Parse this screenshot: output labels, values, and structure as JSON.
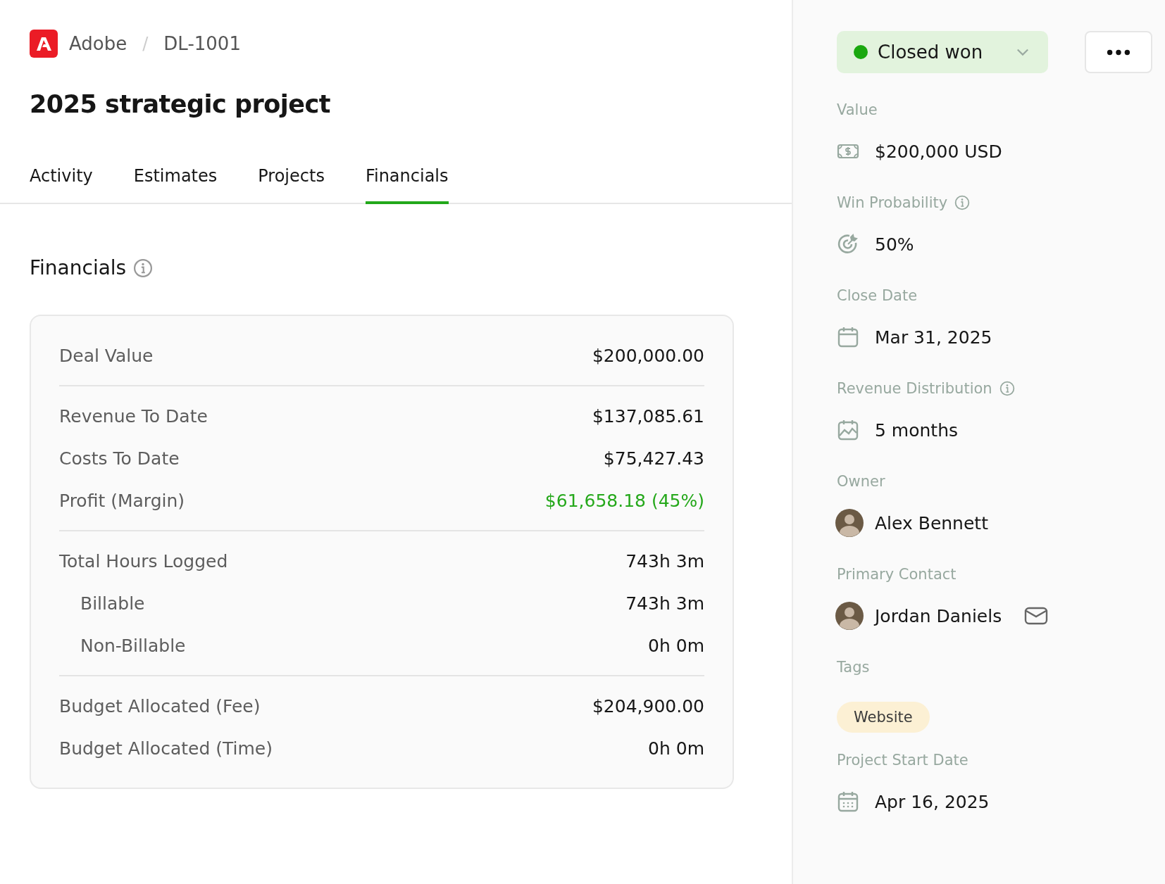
{
  "breadcrumb": {
    "company": "Adobe",
    "separator": "/",
    "deal_id": "DL-1001"
  },
  "title": "2025 strategic project",
  "tabs": [
    {
      "label": "Activity",
      "selected": false
    },
    {
      "label": "Estimates",
      "selected": false
    },
    {
      "label": "Projects",
      "selected": false
    },
    {
      "label": "Financials",
      "selected": true
    }
  ],
  "financials": {
    "heading": "Financials",
    "sections": [
      [
        {
          "label": "Deal Value",
          "value": "$200,000.00",
          "indented": false,
          "positive": false
        }
      ],
      [
        {
          "label": "Revenue To Date",
          "value": "$137,085.61",
          "indented": false,
          "positive": false
        },
        {
          "label": "Costs To Date",
          "value": "$75,427.43",
          "indented": false,
          "positive": false
        },
        {
          "label": "Profit (Margin)",
          "value": "$61,658.18 (45%)",
          "indented": false,
          "positive": true
        }
      ],
      [
        {
          "label": "Total Hours Logged",
          "value": "743h 3m",
          "indented": false,
          "positive": false
        },
        {
          "label": "Billable",
          "value": "743h 3m",
          "indented": true,
          "positive": false
        },
        {
          "label": "Non-Billable",
          "value": "0h 0m",
          "indented": true,
          "positive": false
        }
      ],
      [
        {
          "label": "Budget Allocated (Fee)",
          "value": "$204,900.00",
          "indented": false,
          "positive": false
        },
        {
          "label": "Budget Allocated (Time)",
          "value": "0h 0m",
          "indented": false,
          "positive": false
        }
      ]
    ]
  },
  "sidebar": {
    "status": {
      "label": "Closed won",
      "color": "#1aa80f"
    },
    "fields": [
      {
        "label": "Value",
        "kind": "money",
        "value": "$200,000 USD",
        "info": false
      },
      {
        "label": "Win Probability",
        "kind": "target",
        "value": "50%",
        "info": true
      },
      {
        "label": "Close Date",
        "kind": "calendar",
        "value": "Mar 31, 2025",
        "info": false
      },
      {
        "label": "Revenue Distribution",
        "kind": "chart",
        "value": "5 months",
        "info": true
      },
      {
        "label": "Owner",
        "kind": "person",
        "value": "Alex Bennett",
        "info": false,
        "email": false
      },
      {
        "label": "Primary Contact",
        "kind": "person",
        "value": "Jordan Daniels",
        "info": false,
        "email": true
      },
      {
        "label": "Tags",
        "kind": "tag",
        "value": "Website",
        "info": false
      },
      {
        "label": "Project Start Date",
        "kind": "date-grid",
        "value": "Apr 16, 2025",
        "info": false
      }
    ]
  }
}
